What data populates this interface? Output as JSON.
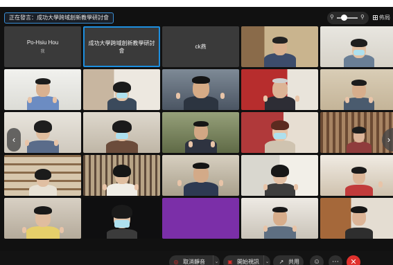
{
  "header": {
    "speaking_label": "正在發言：",
    "speaking_name": "成功大學跨域創新教學研討會",
    "view_label": "佈局"
  },
  "grid": {
    "row1": [
      {
        "name": "Po-Hsiu Hou",
        "sub": "我"
      },
      {
        "name": "成功大學跨域創新教學研討會"
      },
      {
        "name": "ck燕"
      }
    ]
  },
  "toolbar": {
    "mute_label": "取消靜音",
    "video_label": "開始視訊",
    "share_label": "共用"
  },
  "icons": {
    "mute": "microphone-muted-icon",
    "video": "video-off-icon",
    "share": "share-icon",
    "reactions": "smile-icon",
    "more": "more-icon",
    "leave": "close-icon",
    "zoom_out": "zoom-out-icon",
    "zoom_in": "zoom-in-icon",
    "layout": "grid-icon"
  },
  "colors": {
    "active_border": "#1d8fe0",
    "leave": "#e0312d",
    "tile_bg": "#3a3a3a"
  }
}
